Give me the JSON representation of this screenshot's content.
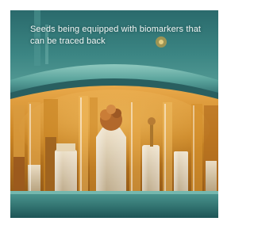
{
  "caption": {
    "text": "Seeds being equipped with biomarkers that can be traced back"
  },
  "image": {
    "subject": "laboratory-glassware-with-seeds-photo",
    "colors": {
      "teal_frame": "#3d8c8a",
      "teal_dark": "#1f5a5c",
      "amber_liquid": "#c98424",
      "seed_beige": "#d9c9a8"
    }
  }
}
